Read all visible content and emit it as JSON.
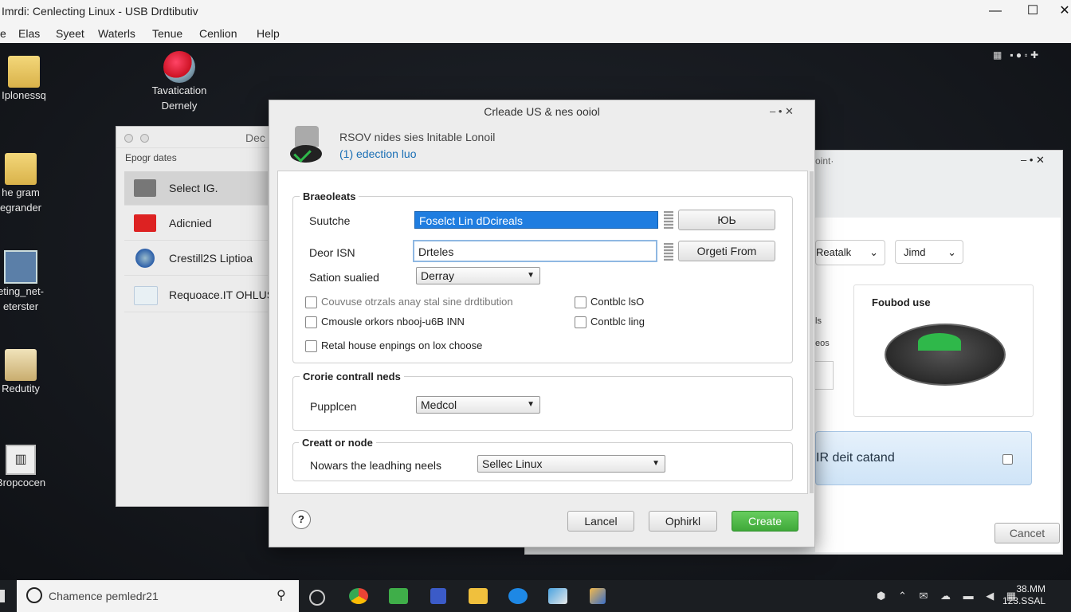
{
  "window": {
    "title": "Imrdi: Cenlecting Linux - USB Drdtibutiv",
    "min": "—",
    "max": "☐",
    "close": "✕"
  },
  "menu": [
    "e",
    "Elas",
    "Syeet",
    "Waterls",
    "Tenue",
    "Cenlion",
    "Help"
  ],
  "desktop_icons": [
    {
      "label1": "Iplonessq",
      "label2": ""
    },
    {
      "label1": "Tavatication",
      "label2": "Dernely"
    },
    {
      "label1": "he gram",
      "label2": "egrander"
    },
    {
      "label1": "eting_net-",
      "label2": "eterster"
    },
    {
      "label1": "Redutity",
      "label2": ""
    },
    {
      "label1": "Bropcocen",
      "label2": ""
    }
  ],
  "left_window": {
    "title": "Dec",
    "section": "Epogr dates",
    "items": [
      {
        "label": "Select IG.",
        "color": "#777777"
      },
      {
        "label": "Adicnied",
        "color": "#dd2222"
      },
      {
        "label": "Crestill2S Liptioa",
        "color": "#2b5ea8"
      },
      {
        "label": "Requoace.IT OHLUSR",
        "color": "#cfe3f0"
      }
    ]
  },
  "right_window": {
    "title": "oint·",
    "controls": "–  •  ✕",
    "tabs": [
      "Reatalk",
      "Jimd"
    ],
    "side1": "ls",
    "side2": "eos",
    "card_label": "Foubod use",
    "banner_text": "IR deit catand",
    "cancel": "Cancet",
    "accent": "#2fb84a"
  },
  "dialog": {
    "title": "Crleade  US & nes ooiol",
    "controls": "–  •  ✕",
    "header_line1": "RSOV nides sies lnitable Lonoil",
    "header_line2": "(1)  edection luo",
    "header_line2_color": "#1a6fb5",
    "group1": {
      "title": "Braeoleats",
      "row1_label": "Suutche",
      "row1_value": "Foselct Lin dDcireals",
      "row1_button": "ЮЬ",
      "row2_label": "Deor ISN",
      "row2_value": "Drteles",
      "row2_button": "Orgeti From",
      "row3_label": "Sation sualied",
      "row3_select": "Derray",
      "checkboxes": [
        "Couvuse otrzals anay stal sine drdtibution",
        "Cmousle orkors nbooj-u6B INN",
        "Retal house enpings on lox choose",
        "Contblc lsO",
        "Contblc ling"
      ]
    },
    "group2": {
      "title": "Crorie contrall neds",
      "label": "Pupplcen",
      "select": "Medcol"
    },
    "group3": {
      "title": "Creatt or node",
      "label": "Nowars the leadhing neels",
      "select": "Sellec Linux"
    },
    "buttons": {
      "help": "?",
      "cancel": "Lancel",
      "option": "Ophirkl",
      "create": "Create"
    },
    "create_color": "#4fb84a"
  },
  "taskbar": {
    "search": "Chamence pemledr21",
    "time": "38.MM",
    "date": "123.SSAL"
  }
}
